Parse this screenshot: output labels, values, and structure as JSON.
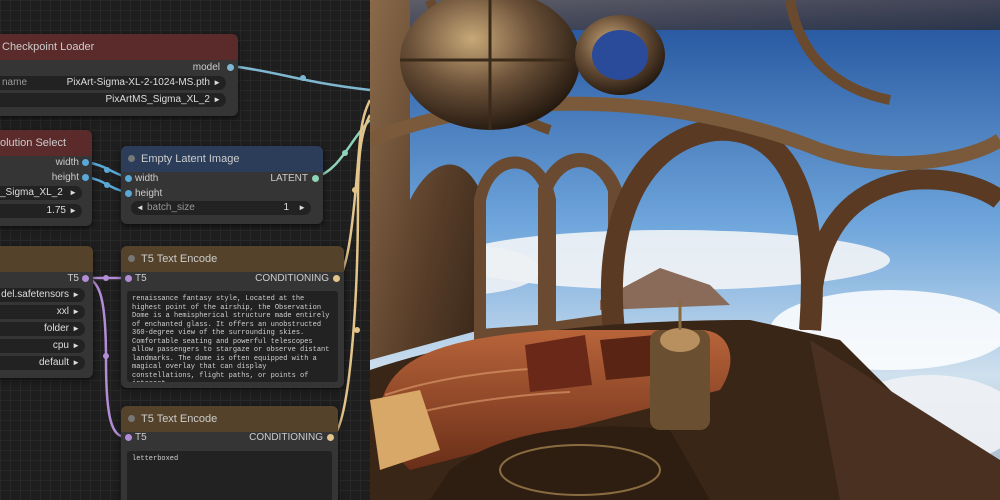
{
  "nodes": {
    "checkpoint_loader": {
      "title": "Checkpoint Loader",
      "output_model": "model",
      "ckpt_label": "name",
      "ckpt_value": "PixArt-Sigma-XL-2-1024-MS.pth",
      "model_value": "PixArtMS_Sigma_XL_2"
    },
    "resolution_select": {
      "title": "olution Select",
      "output_width": "width",
      "output_height": "height",
      "model_value": "_Sigma_XL_2",
      "ratio_value": "1.75"
    },
    "empty_latent": {
      "title": "Empty Latent Image",
      "input_width": "width",
      "input_height": "height",
      "output_latent": "LATENT",
      "batch_label": "batch_size",
      "batch_value": "1"
    },
    "t5_loader": {
      "output_t5": "T5",
      "values": [
        "del.safetensors",
        "xxl",
        "folder",
        "cpu",
        "default"
      ]
    },
    "t5_encode_1": {
      "title": "T5 Text Encode",
      "input_t5": "T5",
      "output_cond": "CONDITIONING",
      "text": "renaissance fantasy style, Located at the highest point of the airship, the Observation Dome is a hemispherical structure made entirely of enchanted glass. It offers an unobstructed 360-degree view of the surrounding skies. Comfortable seating and powerful telescopes allow passengers to stargaze or observe distant landmarks. The dome is often equipped with a magical overlay that can display constellations, flight paths, or points of interest."
    },
    "t5_encode_2": {
      "title": "T5 Text Encode",
      "input_t5": "T5",
      "output_cond": "CONDITIONING",
      "text": "letterboxed"
    }
  },
  "colors": {
    "model_wire": "#7fb7d0",
    "int_wire": "#5aa8d6",
    "latent_wire": "#8fd3b8",
    "t5_wire": "#b38cd6",
    "cond_wire": "#e3c48a"
  },
  "icons": {
    "arrow_right": "►",
    "arrow_left": "◄"
  }
}
